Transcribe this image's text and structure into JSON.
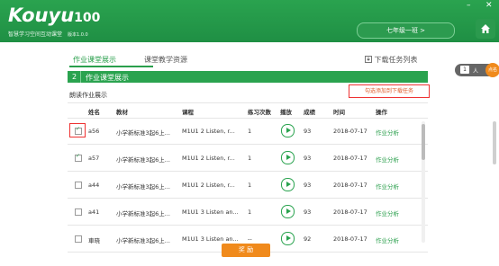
{
  "app": {
    "logo_text": "Kouyu",
    "logo_num": "100",
    "subtitle": "智慧学习空间互动课堂",
    "version": "版本1.0.0",
    "minimize": "–",
    "close": "✕"
  },
  "header": {
    "class_label": "七年级一班 >"
  },
  "tabs": {
    "active": "作业课堂展示",
    "other": "课堂教学资源",
    "download_list": "下载任务列表"
  },
  "side": {
    "count": "1",
    "unit": "人",
    "badge": "点名"
  },
  "section": {
    "index": "2",
    "title": "作业课堂展示"
  },
  "panel": {
    "title": "朗读作业展示",
    "add_link": "勾选添加到下载任务"
  },
  "table": {
    "headers": [
      "姓名",
      "教材",
      "课程",
      "练习次数",
      "播放",
      "成绩",
      "时间",
      "操作"
    ],
    "rows": [
      {
        "checked": true,
        "name": "a56",
        "book": "小学新标准3起6上...",
        "course": "M1U1 2 Listen, r...",
        "times": "1",
        "score": "93",
        "date": "2018-07-17",
        "op": "作业分析"
      },
      {
        "checked": true,
        "name": "a57",
        "book": "小学新标准3起6上...",
        "course": "M1U1 2 Listen, r...",
        "times": "1",
        "score": "93",
        "date": "2018-07-17",
        "op": "作业分析"
      },
      {
        "checked": false,
        "name": "a44",
        "book": "小学新标准3起6上...",
        "course": "M1U1 2 Listen, r...",
        "times": "1",
        "score": "93",
        "date": "2018-07-17",
        "op": "作业分析"
      },
      {
        "checked": false,
        "name": "a41",
        "book": "小学新标准3起6上...",
        "course": "M1U1 3 Listen an...",
        "times": "1",
        "score": "93",
        "date": "2018-07-17",
        "op": "作业分析"
      },
      {
        "checked": false,
        "name": "車晓",
        "book": "小学新标准3起6上...",
        "course": "M1U1 3 Listen an...",
        "times": "--",
        "score": "92",
        "date": "2018-07-17",
        "op": "作业分析"
      }
    ]
  },
  "footer": {
    "reward_label": "奖 励"
  },
  "colors": {
    "brand_green": "#2aa34f",
    "accent_orange": "#f08a1c",
    "highlight_red": "#e33333"
  }
}
